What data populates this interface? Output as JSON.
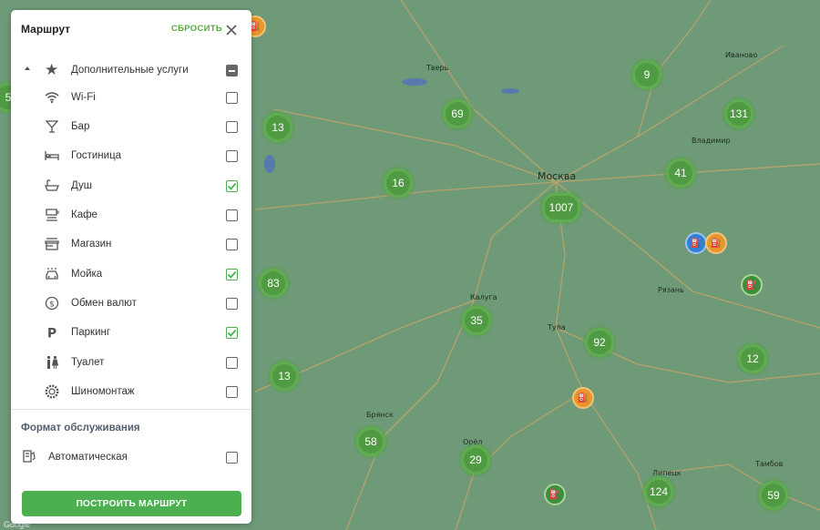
{
  "panel": {
    "title": "Маршрут",
    "reset_label": "СБРОСИТЬ",
    "group": {
      "label": "Дополнительные услуги",
      "icon": "star-icon",
      "state": "indeterminate",
      "expanded": true
    },
    "items": [
      {
        "label": "Wi-Fi",
        "icon": "wifi-icon",
        "checked": false
      },
      {
        "label": "Бар",
        "icon": "cocktail-icon",
        "checked": false
      },
      {
        "label": "Гостиница",
        "icon": "bed-icon",
        "checked": false
      },
      {
        "label": "Душ",
        "icon": "bathtub-icon",
        "checked": true
      },
      {
        "label": "Кафе",
        "icon": "coffee-cup-icon",
        "checked": false
      },
      {
        "label": "Магазин",
        "icon": "store-icon",
        "checked": false
      },
      {
        "label": "Мойка",
        "icon": "car-wash-icon",
        "checked": true
      },
      {
        "label": "Обмен валют",
        "icon": "currency-icon",
        "checked": false
      },
      {
        "label": "Паркинг",
        "icon": "parking-icon",
        "checked": true
      },
      {
        "label": "Туалет",
        "icon": "restroom-icon",
        "checked": false
      },
      {
        "label": "Шиномонтаж",
        "icon": "tire-icon",
        "checked": false
      }
    ],
    "service_format": {
      "title": "Формат обслуживания",
      "items": [
        {
          "label": "Автоматическая",
          "icon": "fuel-terminal-icon",
          "checked": false
        }
      ]
    },
    "build_button": "ПОСТРОИТЬ МАРШРУТ"
  },
  "map": {
    "cities": [
      "Тверь",
      "Москва",
      "Иваново",
      "Владимир",
      "Рязань",
      "Калуга",
      "Тула",
      "Брянск",
      "Орёл",
      "Липецк",
      "Тамбов"
    ],
    "clusters": [
      "13",
      "69",
      "9",
      "131",
      "16",
      "1007",
      "41",
      "83",
      "35",
      "92",
      "12",
      "13",
      "58",
      "29",
      "124",
      "59",
      "5"
    ],
    "google_label": "Google",
    "colors": {
      "map_bg": "#6f9a78",
      "cluster": "#4f9a42",
      "accent": "#4caf50",
      "station_orange": "#e8962a",
      "station_blue": "#2f7fd6"
    }
  }
}
